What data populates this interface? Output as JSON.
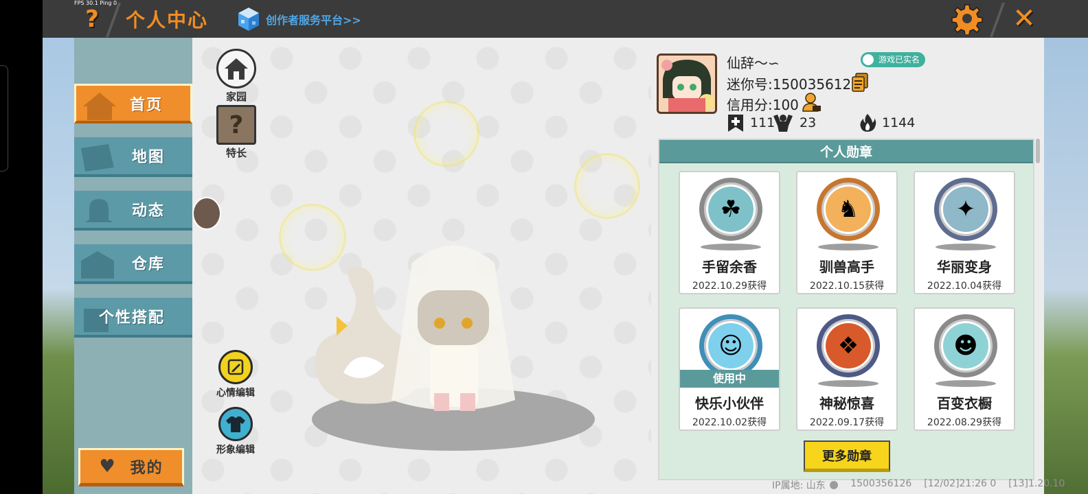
{
  "header": {
    "fps": "FPS 30.1  Ping 0",
    "help_icon": "?",
    "title": "个人中心",
    "creator_link": "创作者服务平台>>",
    "close_icon": "✕"
  },
  "sidebar": {
    "items": [
      {
        "label": "首页",
        "icon": "home-icon",
        "active": true
      },
      {
        "label": "地图",
        "icon": "map-icon",
        "active": false
      },
      {
        "label": "动态",
        "icon": "bell-icon",
        "active": false
      },
      {
        "label": "仓库",
        "icon": "warehouse-icon",
        "active": false
      },
      {
        "label": "个性搭配",
        "icon": "outfit-icon",
        "active": false
      }
    ],
    "mine_label": "我的"
  },
  "center": {
    "home_label": "家园",
    "skill_label": "特长",
    "skill_glyph": "?",
    "mood_label": "心情编辑",
    "appearance_label": "形象编辑"
  },
  "profile": {
    "nickname": "仙辞～∽",
    "realname_badge": "游戏已实名",
    "uid": "迷你号:1500356126",
    "credit": "信用分:100",
    "stats": {
      "bookmarks": "111",
      "fans": "23",
      "heat": "1144"
    }
  },
  "medals": {
    "title": "个人勋章",
    "items": [
      {
        "name": "手留余香",
        "date": "2022.10.29获得",
        "in_use": false,
        "ring": "#8a8a8a",
        "fill": "#7fc1c9",
        "glyph": "☘"
      },
      {
        "name": "驯兽高手",
        "date": "2022.10.15获得",
        "in_use": false,
        "ring": "#c7762f",
        "fill": "#f2b15a",
        "glyph": "♞"
      },
      {
        "name": "华丽变身",
        "date": "2022.10.04获得",
        "in_use": false,
        "ring": "#5e6d8f",
        "fill": "#8fb8c9",
        "glyph": "✦"
      },
      {
        "name": "快乐小伙伴",
        "date": "2022.10.02获得",
        "in_use": true,
        "ring": "#3f8fb8",
        "fill": "#7fd0ec",
        "glyph": "☺"
      },
      {
        "name": "神秘惊喜",
        "date": "2022.09.17获得",
        "in_use": false,
        "ring": "#4e5a86",
        "fill": "#d85a2b",
        "glyph": "❖"
      },
      {
        "name": "百变衣橱",
        "date": "2022.08.29获得",
        "in_use": false,
        "ring": "#8a8a8a",
        "fill": "#8fd2d6",
        "glyph": "☻"
      }
    ],
    "in_use_label": "使用中",
    "more_label": "更多勋章"
  },
  "footer": {
    "ip": "IP属地: 山东",
    "uid": "1500356126",
    "time": "[12/02]21:26 0",
    "version": "[13]1.20.10"
  },
  "colors": {
    "accent": "#f18d22",
    "teal": "#5b9a9a",
    "yellow": "#f7d51c"
  }
}
